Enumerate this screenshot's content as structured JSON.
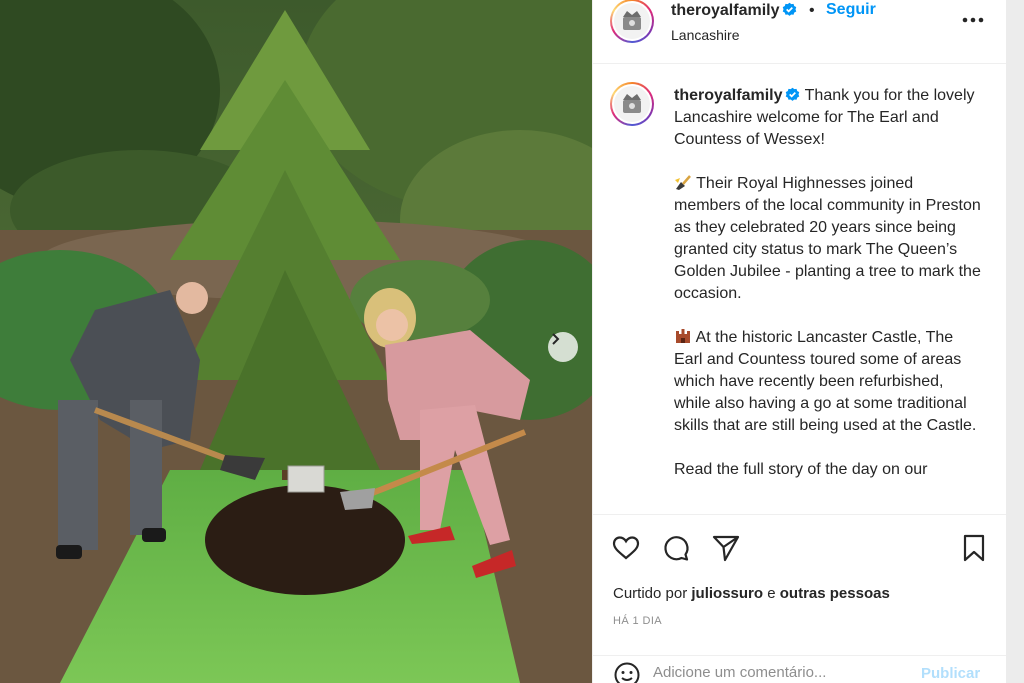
{
  "header": {
    "username": "theroyalfamily",
    "separator": "•",
    "follow_label": "Seguir",
    "location": "Lancashire"
  },
  "caption": {
    "username": "theroyalfamily",
    "intro": "Thank you for the lovely Lancashire welcome for The Earl and Countess of Wessex!",
    "para1_emoji": "shovel-emoji",
    "para1": "Their Royal Highnesses joined members of the local community in Preston as they celebrated 20 years since being granted city status to mark The Queen’s Golden Jubilee - planting a tree to mark the occasion.",
    "para2_emoji": "castle-emoji",
    "para2": "At the historic Lancaster Castle, The Earl and Countess toured some of areas which have recently been refurbished, while also having a go at some traditional skills that are still being used at the Castle.",
    "para3": "Read the full story of the day on our"
  },
  "likes": {
    "prefix": "Curtido por",
    "user": "juliossuro",
    "conjunction": "e",
    "others": "outras pessoas"
  },
  "timestamp": "HÁ 1 DIA",
  "comment_box": {
    "placeholder": "Adicione um comentário...",
    "publish_label": "Publicar"
  },
  "icons": [
    "verified-badge-icon",
    "more-options-icon",
    "heart-icon",
    "comment-icon",
    "share-icon",
    "bookmark-icon",
    "emoji-icon",
    "next-arrow-icon",
    "royal-crest-icon"
  ],
  "colors": {
    "accent": "#0095f6",
    "verified": "#0095f6",
    "text": "#262626",
    "muted": "#8e8e8e"
  }
}
